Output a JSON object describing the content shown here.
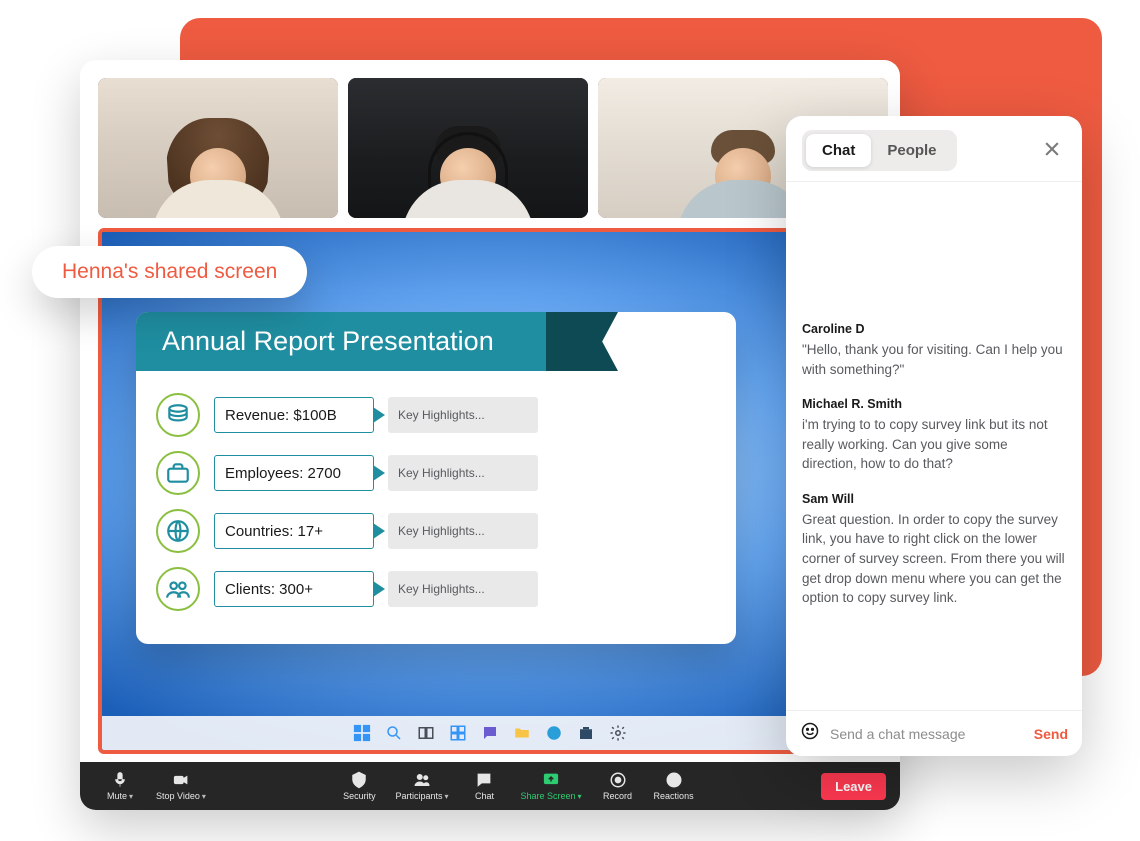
{
  "share_label": "Henna's shared screen",
  "slide": {
    "title": "Annual Report Presentation",
    "highlight_label": "Key Highlights...",
    "rows": [
      {
        "label": "Revenue: $100B"
      },
      {
        "label": "Employees: 2700"
      },
      {
        "label": "Countries: 17+"
      },
      {
        "label": "Clients: 300+"
      }
    ]
  },
  "toolbar": {
    "mute": "Mute",
    "stop_video": "Stop Video",
    "security": "Security",
    "participants": "Participants",
    "chat": "Chat",
    "share_screen": "Share Screen",
    "record": "Record",
    "reactions": "Reactions",
    "leave": "Leave"
  },
  "chat": {
    "tabs": {
      "chat": "Chat",
      "people": "People"
    },
    "close": "×",
    "messages": [
      {
        "name": "Caroline D",
        "body": "\"Hello, thank you for visiting. Can I help you with something?\""
      },
      {
        "name": "Michael R. Smith",
        "body": "i'm trying to to copy survey link but its not really working. Can you give some direction, how to do that?"
      },
      {
        "name": "Sam Will",
        "body": "Great question. In order to copy the survey link, you have to right click on the lower corner of survey screen. From there you will get drop down menu where you can get the option to copy survey link."
      }
    ],
    "placeholder": "Send a chat message",
    "send": "Send"
  },
  "colors": {
    "accent": "#ee5b41",
    "teal": "#1f8ea1",
    "green": "#2ecc71"
  }
}
